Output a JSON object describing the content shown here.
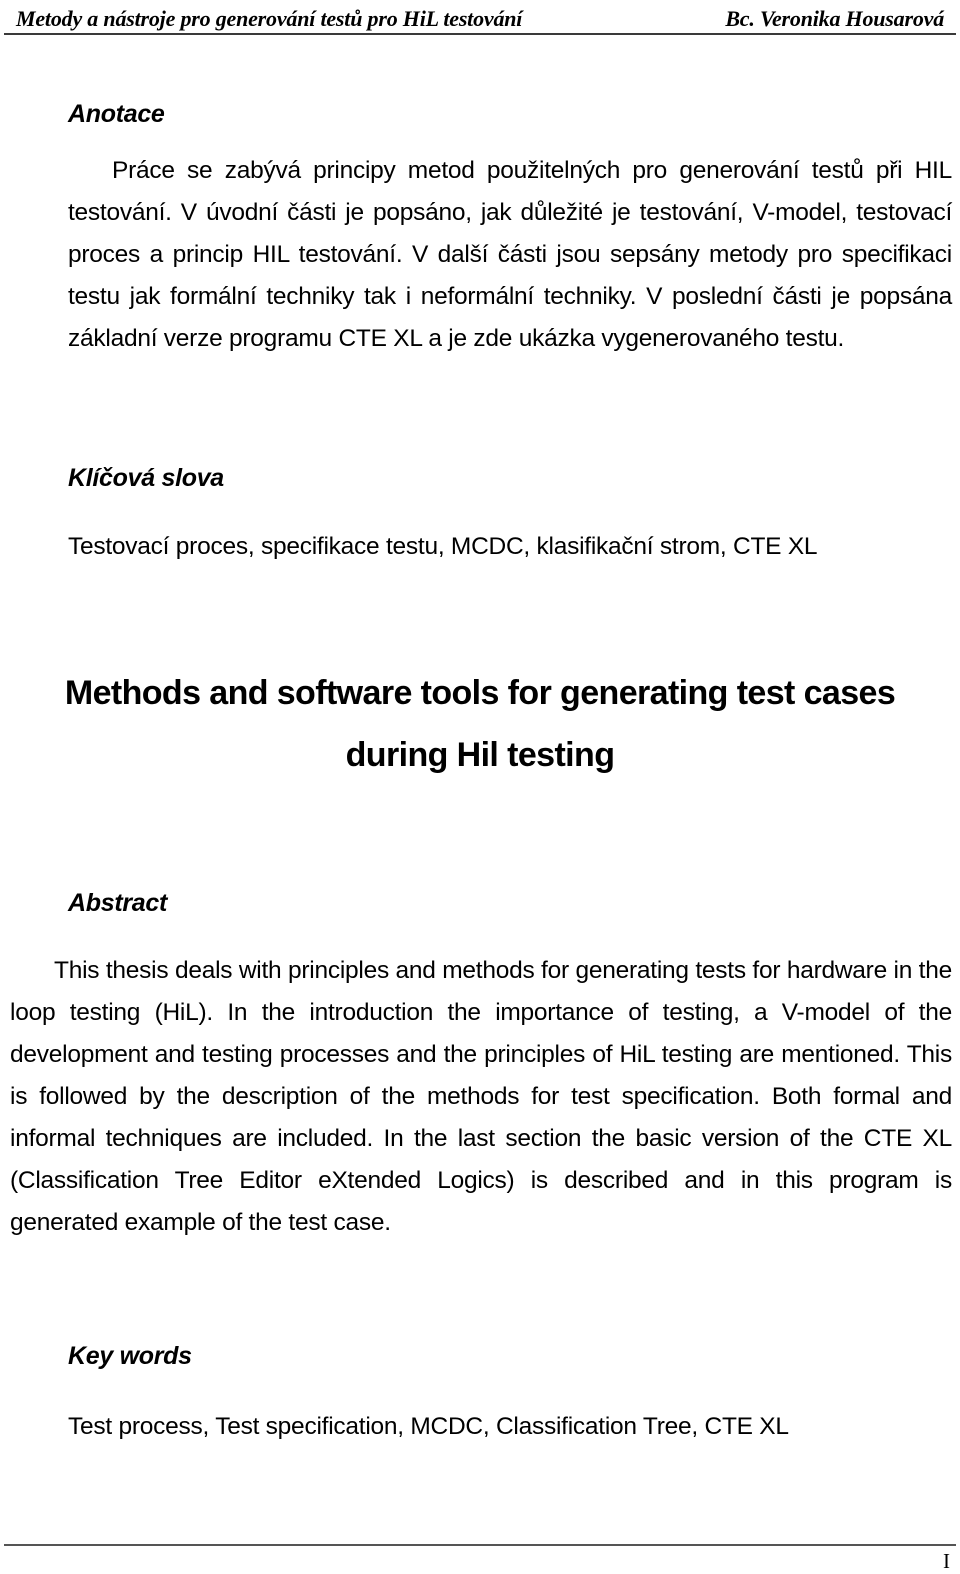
{
  "document": {
    "header": {
      "title": "Metody a nástroje pro generování testů pro HiL testování",
      "author": "Bc. Veronika Housarová"
    },
    "footer": {
      "page_number": "I"
    },
    "sections": {
      "anotace": {
        "heading": "Anotace",
        "paragraph": "Práce se zabývá principy metod použitelných pro generování testů při HIL testování. V úvodní části je popsáno, jak důležité je testování, V-model, testovací proces a princip HIL testování. V další části jsou sepsány metody pro specifikaci testu jak formální techniky tak i neformální techniky. V poslední části je popsána základní verze programu CTE XL a je zde ukázka vygenerovaného testu."
      },
      "klicova_slova": {
        "heading": "Klíčová slova",
        "paragraph": "Testovací proces, specifikace testu, MCDC, klasifikační strom, CTE XL"
      },
      "title_en": {
        "line1": "Methods and software tools for generating test cases",
        "line2": "during Hil testing"
      },
      "abstract": {
        "heading": "Abstract",
        "paragraph": "This thesis deals with principles and methods for generating tests for hardware in the loop testing (HiL). In the introduction the importance of testing, a V-model of the development and testing processes and the principles of HiL testing are mentioned. This is followed by the description of the methods for test specification. Both formal and informal techniques are included. In the last section the basic version of the CTE XL (Classification Tree Editor eXtended Logics) is described and in this program is generated example of the test case."
      },
      "key_words": {
        "heading": "Key words",
        "paragraph": "Test process, Test specification, MCDC, Classification Tree, CTE XL"
      }
    }
  }
}
